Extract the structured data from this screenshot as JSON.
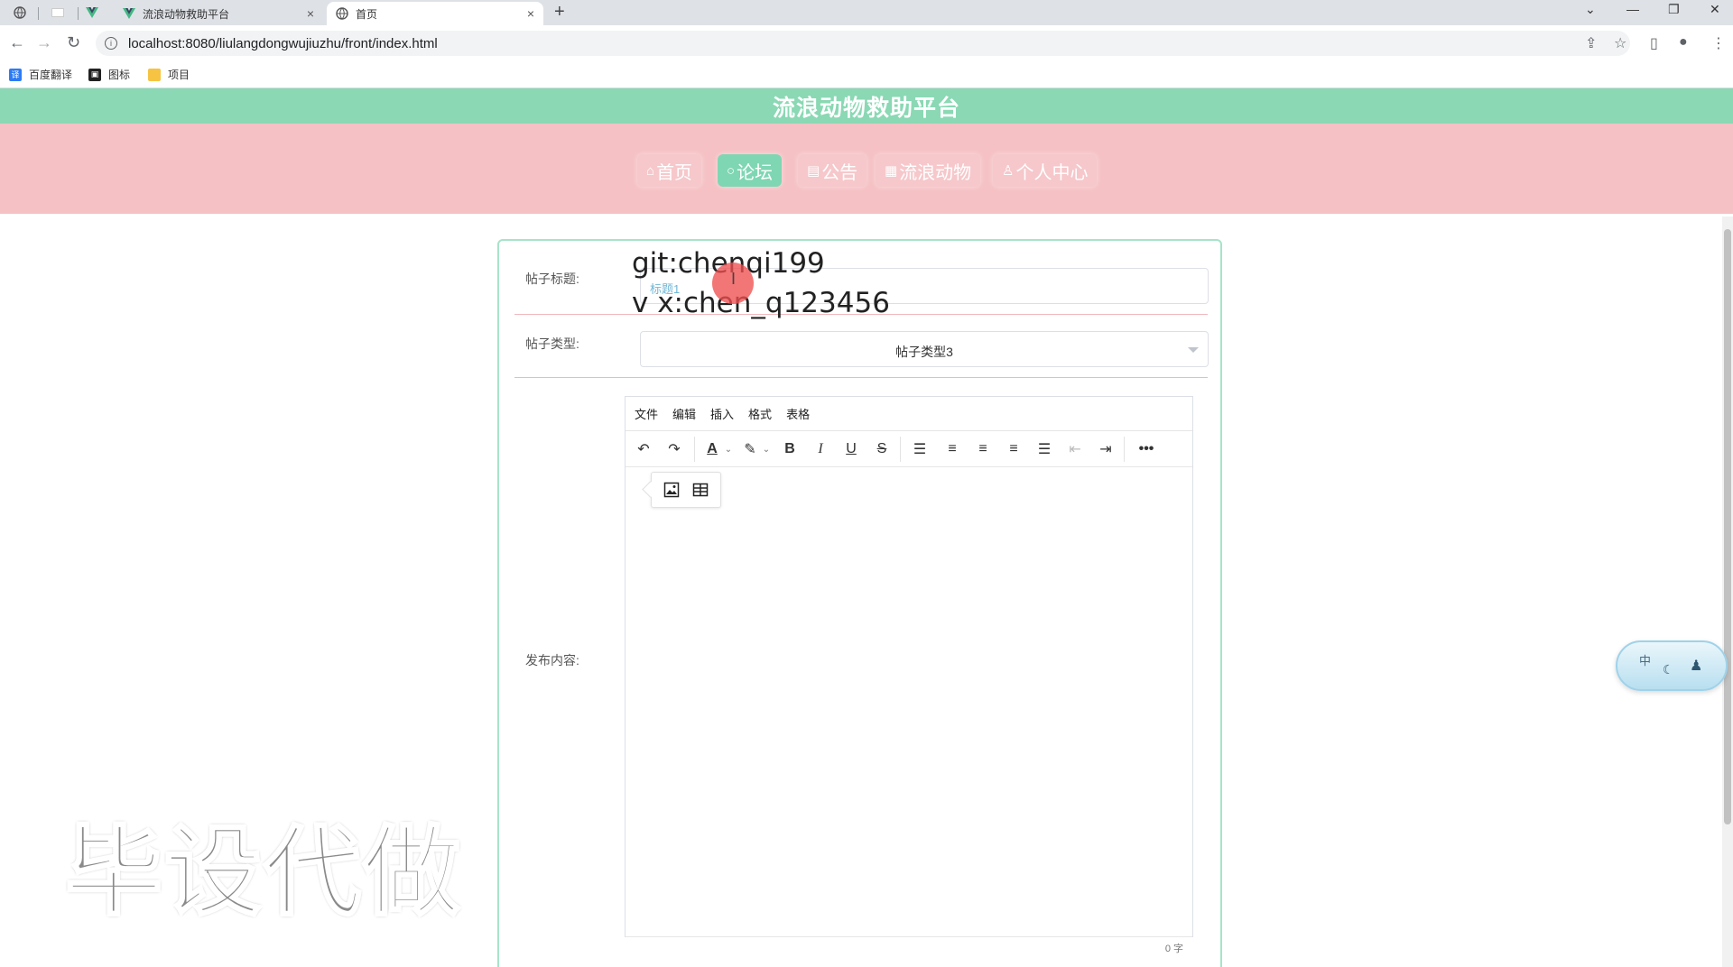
{
  "browser": {
    "tabs": [
      {
        "title": "流浪动物救助平台",
        "close": "×"
      },
      {
        "title": "首页",
        "close": "×"
      }
    ],
    "new_tab": "+",
    "url": "localhost:8080/liulangdongwujiuzhu/front/index.html",
    "bookmarks": [
      "百度翻译",
      "图标",
      "项目"
    ]
  },
  "site": {
    "title": "流浪动物救助平台",
    "nav": [
      {
        "icon": "⌂",
        "label": "首页"
      },
      {
        "icon": "○",
        "label": "论坛"
      },
      {
        "icon": "▤",
        "label": "公告"
      },
      {
        "icon": "▦",
        "label": "流浪动物"
      },
      {
        "icon": "♙",
        "label": "个人中心"
      }
    ],
    "active_nav": "论坛"
  },
  "form": {
    "title_label": "帖子标题:",
    "title_value": "标题1",
    "type_label": "帖子类型:",
    "type_value": "帖子类型3",
    "content_label": "发布内容:"
  },
  "editor": {
    "menus": [
      "文件",
      "编辑",
      "插入",
      "格式",
      "表格"
    ],
    "word_count": "0 字"
  },
  "overlay": {
    "line1": "git:chenqi199",
    "line2": "v x:chen_q123456",
    "watermark": "毕设代做",
    "widget_lang": "中"
  },
  "colors": {
    "header_green": "#8ad8b4",
    "nav_pink": "#f5c1c4",
    "active_green": "#7fd6b3",
    "card_border": "#a6e4c9"
  }
}
